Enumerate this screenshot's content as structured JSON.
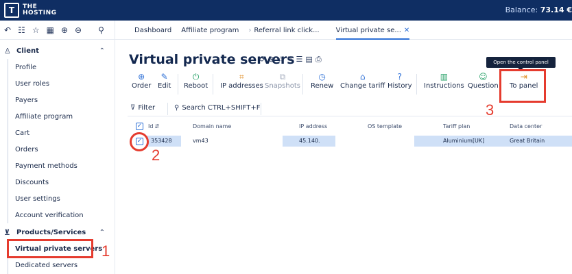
{
  "header": {
    "logo_mark": "T",
    "logo_line1": "THE",
    "logo_line2": "HOSTING",
    "balance_label": "Balance:",
    "balance_value": "73.14 €"
  },
  "breadcrumbs": [
    "Dashboard",
    "Affiliate program",
    "Referral link click...",
    "Virtual private se..."
  ],
  "sidebar": {
    "client_group": "Client",
    "client_items": [
      "Profile",
      "User roles",
      "Payers",
      "Affiliate program",
      "Cart",
      "Orders",
      "Payment methods",
      "Discounts",
      "User settings",
      "Account verification"
    ],
    "products_group": "Products/Services",
    "products_items": [
      "Virtual private servers",
      "Dedicated servers"
    ]
  },
  "main": {
    "title": "Virtual private servers",
    "toolbar": [
      "Order",
      "Edit",
      "Reboot",
      "IP addresses",
      "Snapshots",
      "Renew",
      "Change tariff",
      "History",
      "Instructions",
      "Question",
      "To panel"
    ],
    "tooltip": "Open the control panel",
    "filter_label": "Filter",
    "search_label": "Search CTRL+SHIFT+F",
    "columns": [
      "Id",
      "Domain name",
      "IP address",
      "OS template",
      "Tariff plan",
      "Data center"
    ],
    "row": {
      "id": "353428",
      "domain": "vm43",
      "ip": "45.140.",
      "os": "",
      "tariff": "Aluminium[UK]",
      "datacenter": "Great Britain"
    }
  },
  "annotations": [
    "1",
    "2",
    "3"
  ],
  "colors": {
    "header_bg": "#0f2e63",
    "accent": "#2d6fd6",
    "annotation": "#e53b2e",
    "row_highlight": "#cfe0f7"
  }
}
